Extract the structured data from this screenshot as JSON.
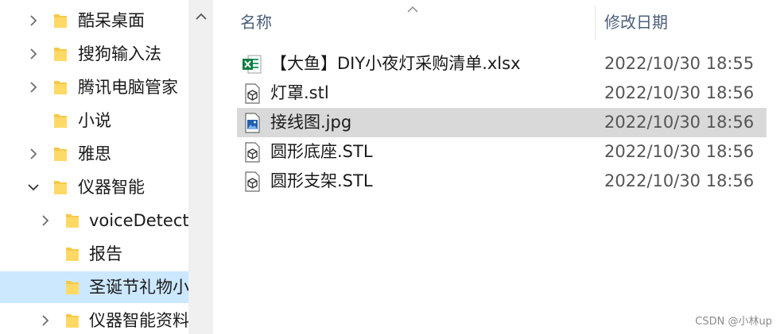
{
  "nav": {
    "items": [
      {
        "label": "酷呆桌面",
        "chevron": "right",
        "selected": false
      },
      {
        "label": "搜狗输入法",
        "chevron": "right",
        "selected": false
      },
      {
        "label": "腾讯电脑管家",
        "chevron": "right",
        "selected": false
      },
      {
        "label": "小说",
        "chevron": "none",
        "selected": false
      },
      {
        "label": "雅思",
        "chevron": "right",
        "selected": false
      },
      {
        "label": "仪器智能",
        "chevron": "down",
        "selected": false
      },
      {
        "label": "voiceDetect",
        "chevron": "right",
        "selected": false
      },
      {
        "label": "报告",
        "chevron": "none",
        "selected": false
      },
      {
        "label": "圣诞节礼物小",
        "chevron": "none",
        "selected": true
      },
      {
        "label": "仪器智能资料",
        "chevron": "right",
        "selected": false
      }
    ]
  },
  "files": {
    "columns": {
      "name": "名称",
      "date": "修改日期"
    },
    "rows": [
      {
        "name": "【大鱼】DIY小夜灯采购清单.xlsx",
        "date": "2022/10/30 18:55",
        "icon": "excel-file-icon",
        "selected": false
      },
      {
        "name": "灯罩.stl",
        "date": "2022/10/30 18:56",
        "icon": "3d-model-file-icon",
        "selected": false
      },
      {
        "name": "接线图.jpg",
        "date": "2022/10/30 18:56",
        "icon": "image-file-icon",
        "selected": true
      },
      {
        "name": "圆形底座.STL",
        "date": "2022/10/30 18:56",
        "icon": "3d-model-file-icon",
        "selected": false
      },
      {
        "name": "圆形支架.STL",
        "date": "2022/10/30 18:56",
        "icon": "3d-model-file-icon",
        "selected": false
      }
    ]
  },
  "watermark": "CSDN @小林up",
  "colors": {
    "nav_selected": "#cce8ff",
    "row_selected": "#d9d9d9",
    "folder": "#f7c948",
    "header_text": "#4c607a"
  }
}
